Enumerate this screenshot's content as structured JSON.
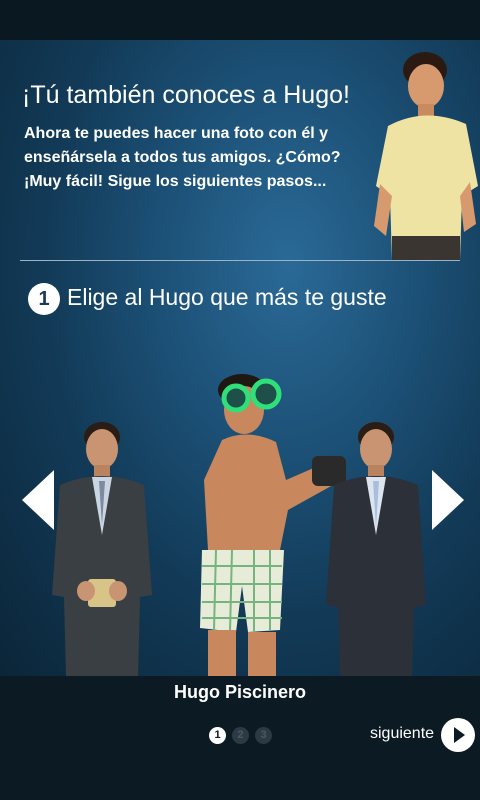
{
  "intro": {
    "title": "¡Tú también conoces a Hugo!",
    "text": "Ahora te puedes hacer una foto con él y enseñársela a todos tus amigos. ¿Cómo? ¡Muy fácil! Sigue los siguientes pasos..."
  },
  "step": {
    "number": "1",
    "label": "Elige al Hugo que más te guste"
  },
  "carousel": {
    "selected_name": "Hugo Piscinero",
    "pages": [
      "1",
      "2",
      "3"
    ],
    "active_page": 1
  },
  "nav": {
    "next_label": "siguiente"
  },
  "icons": {
    "left": "chevron-left-icon",
    "right": "chevron-right-icon",
    "next": "play-circle-icon"
  }
}
